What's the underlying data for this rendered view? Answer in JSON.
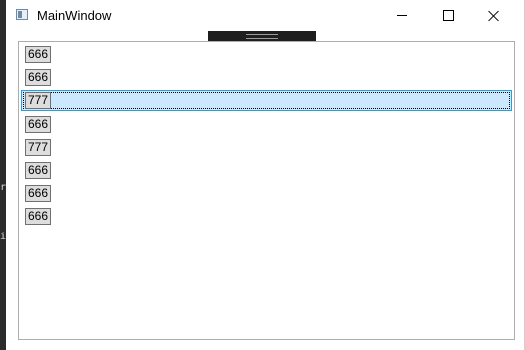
{
  "window": {
    "title": "MainWindow"
  },
  "caption_buttons": {
    "minimize_icon": "minimize-icon",
    "maximize_icon": "maximize-icon",
    "close_icon": "close-icon"
  },
  "list": {
    "selected_index": 2,
    "items": [
      {
        "label": "666"
      },
      {
        "label": "666"
      },
      {
        "label": "777"
      },
      {
        "label": "666"
      },
      {
        "label": "777"
      },
      {
        "label": "666"
      },
      {
        "label": "666"
      },
      {
        "label": "666"
      }
    ]
  },
  "background": {
    "glyph_a": "r",
    "glyph_b": "i"
  },
  "colors": {
    "selection_bg": "#cce8ff",
    "selection_border": "#26a0da",
    "button_bg": "#dddddd"
  }
}
